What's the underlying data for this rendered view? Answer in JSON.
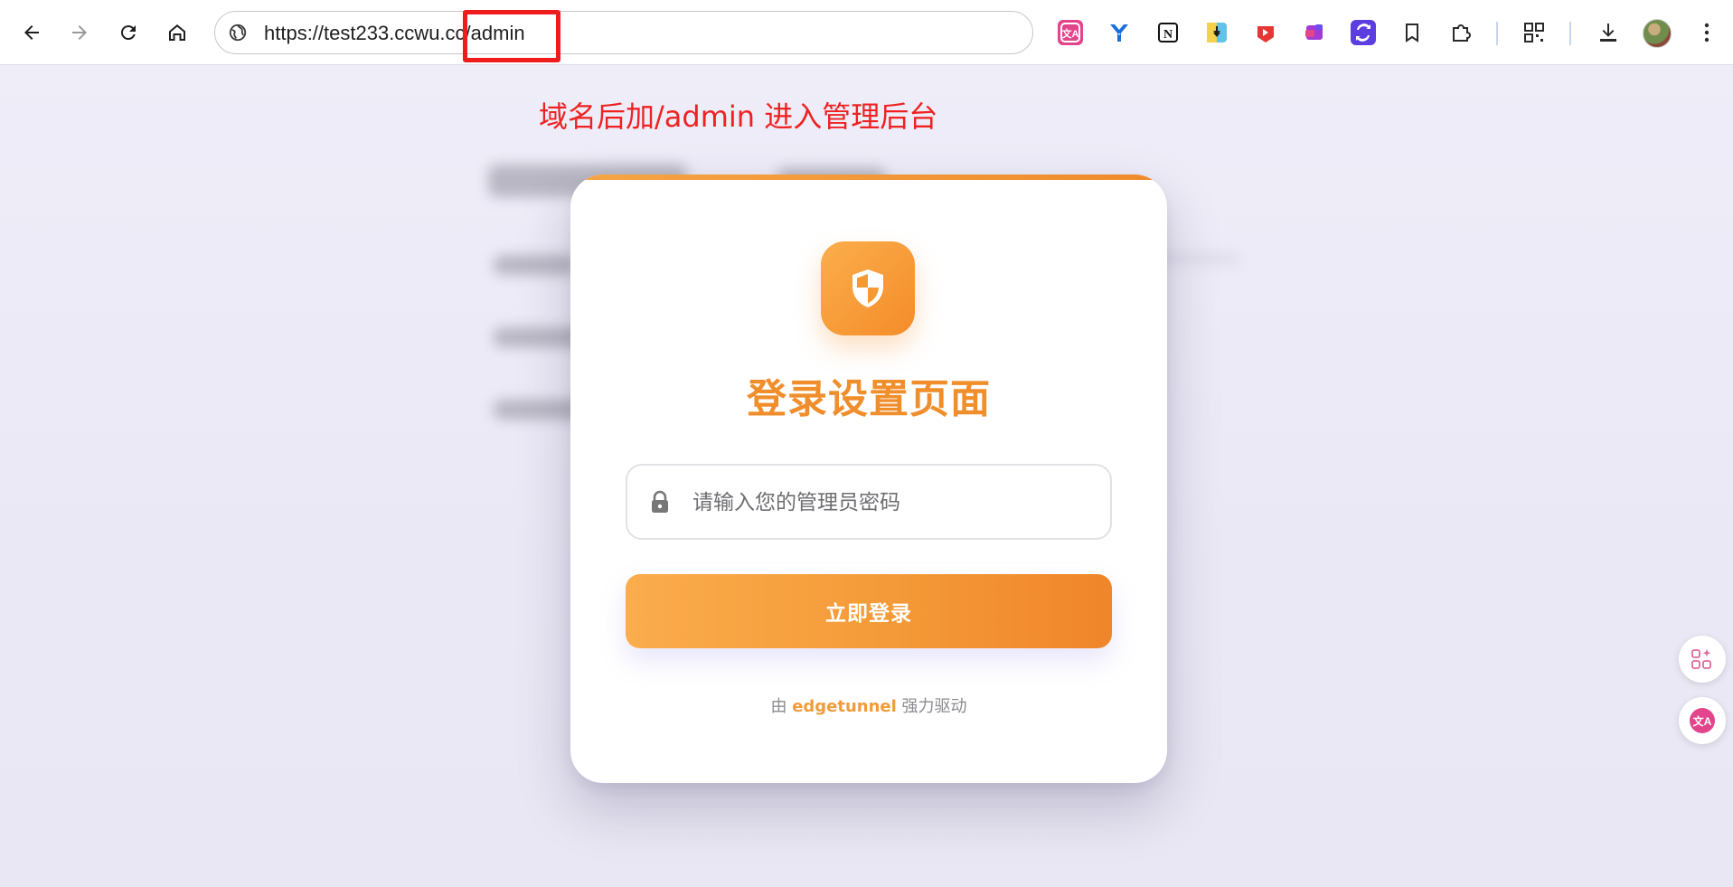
{
  "browser": {
    "url": "https://test233.ccwu.cc/admin",
    "nav": {
      "back": "back-icon",
      "forward": "forward-icon",
      "reload": "reload-icon",
      "home": "home-icon"
    },
    "extensions": [
      "translate-icon",
      "y-extension-icon",
      "notion-icon",
      "download-extension-icon",
      "youtube-icon",
      "office-extension-icon",
      "sync-extension-icon",
      "bookmark-icon",
      "extensions-puzzle-icon",
      "qr-code-icon",
      "downloads-icon",
      "profile-avatar",
      "menu-icon"
    ]
  },
  "annotation": {
    "text": "域名后加/admin 进入管理后台",
    "color": "#ee2222"
  },
  "login": {
    "title": "登录设置页面",
    "password_placeholder": "请输入您的管理员密码",
    "submit_label": "立即登录",
    "footer_prefix": "由",
    "footer_brand": "edgetunnel",
    "footer_suffix": "强力驱动"
  },
  "colors": {
    "accent": "#f08e2c",
    "accent_light": "#fbae4c",
    "highlight": "#ee1c1c"
  }
}
